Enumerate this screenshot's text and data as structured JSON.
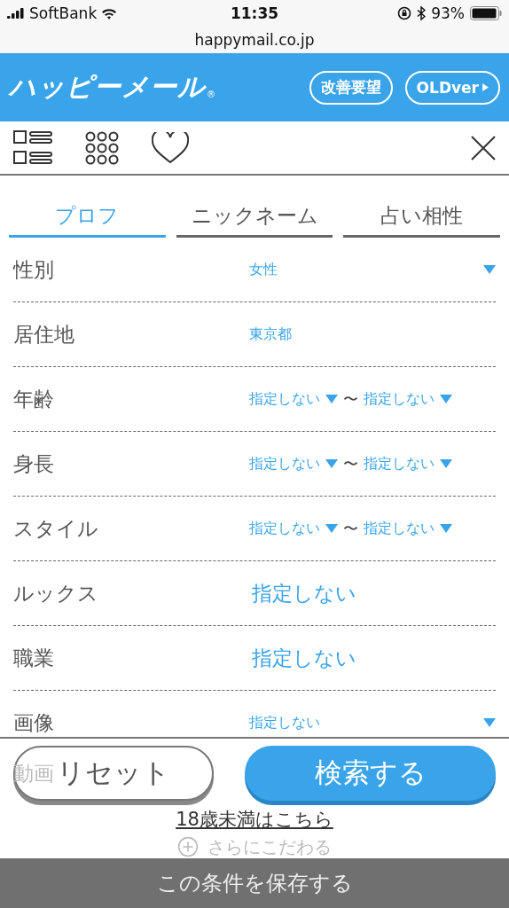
{
  "status_bar": {
    "carrier": "SoftBank",
    "time": "11:35",
    "battery": "93%"
  },
  "url": "happymail.co.jp",
  "header": {
    "logo": "ハッピーメール",
    "logo_mark": "®",
    "buttons": [
      {
        "label": "改善要望",
        "kind": "plain"
      },
      {
        "label": "OLDver",
        "kind": "arrow"
      }
    ]
  },
  "tabs": [
    {
      "label": "プロフ",
      "selected": true
    },
    {
      "label": "ニックネーム",
      "selected": false
    },
    {
      "label": "占い相性",
      "selected": false
    }
  ],
  "fields": [
    {
      "kind": "select",
      "label": "性別",
      "value": "女性"
    },
    {
      "kind": "text",
      "label": "居住地",
      "value": "東京都"
    },
    {
      "kind": "range",
      "label": "年齢",
      "from": "指定しない",
      "separator": "〜",
      "to": "指定しない"
    },
    {
      "kind": "range",
      "label": "身長",
      "from": "指定しない",
      "separator": "〜",
      "to": "指定しない"
    },
    {
      "kind": "range",
      "label": "スタイル",
      "from": "指定しない",
      "separator": "〜",
      "to": "指定しない"
    },
    {
      "kind": "large",
      "label": "ルックス",
      "value": "指定しない"
    },
    {
      "kind": "large",
      "label": "職業",
      "value": "指定しない"
    },
    {
      "kind": "select",
      "label": "画像",
      "value": "指定しない"
    }
  ],
  "faded_row": {
    "label": "動画"
  },
  "buttons": {
    "reset": "リセット",
    "search": "検索する"
  },
  "minor_link": "18歳未満はこちら",
  "more_link": "さらにこだわる",
  "save_bar": "この条件を保存する"
}
